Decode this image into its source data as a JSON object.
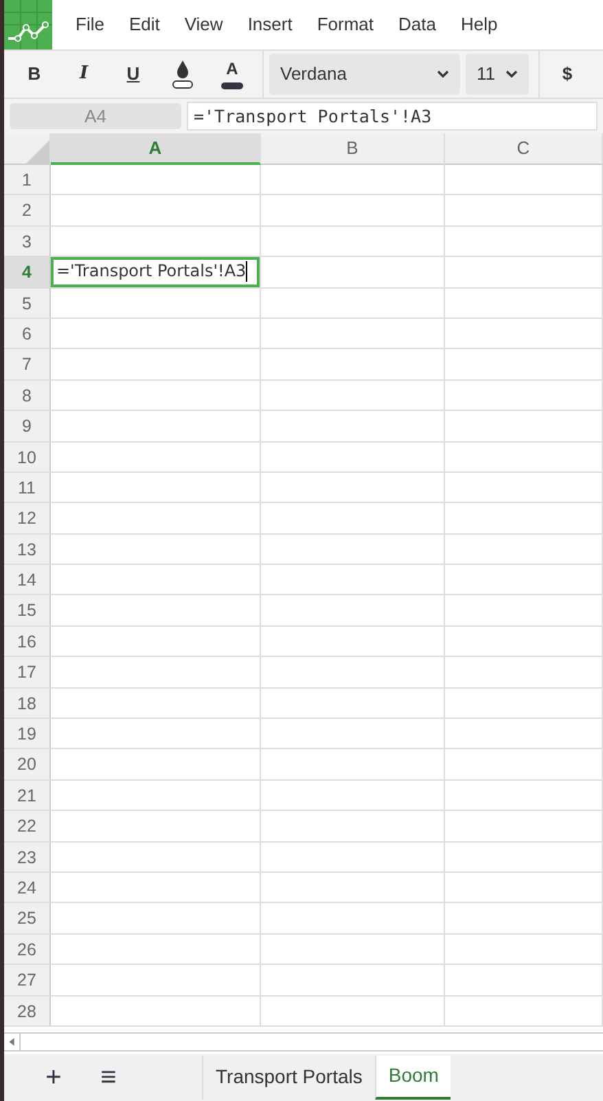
{
  "menu": [
    "File",
    "Edit",
    "View",
    "Insert",
    "Format",
    "Data",
    "Help"
  ],
  "toolbar": {
    "bold": "B",
    "italic": "I",
    "underline": "U",
    "text_color": "A",
    "font": "Verdana",
    "size": "11",
    "currency": "$"
  },
  "name_box": "A4",
  "formula": "='Transport Portals'!A3",
  "columns": [
    {
      "label": "A",
      "selected": true
    },
    {
      "label": "B",
      "selected": false
    },
    {
      "label": "C",
      "selected": false
    }
  ],
  "rows": [
    {
      "label": "1",
      "selected": false
    },
    {
      "label": "2",
      "selected": false
    },
    {
      "label": "3",
      "selected": false
    },
    {
      "label": "4",
      "selected": true,
      "editor_value": "='Transport Portals'!A3"
    },
    {
      "label": "5",
      "selected": false
    },
    {
      "label": "6",
      "selected": false
    },
    {
      "label": "7",
      "selected": false
    },
    {
      "label": "8",
      "selected": false
    },
    {
      "label": "9",
      "selected": false
    },
    {
      "label": "10",
      "selected": false
    },
    {
      "label": "11",
      "selected": false
    },
    {
      "label": "12",
      "selected": false
    },
    {
      "label": "13",
      "selected": false
    },
    {
      "label": "14",
      "selected": false
    },
    {
      "label": "15",
      "selected": false
    },
    {
      "label": "16",
      "selected": false
    },
    {
      "label": "17",
      "selected": false
    },
    {
      "label": "18",
      "selected": false
    },
    {
      "label": "19",
      "selected": false
    },
    {
      "label": "20",
      "selected": false
    },
    {
      "label": "21",
      "selected": false
    },
    {
      "label": "22",
      "selected": false
    },
    {
      "label": "23",
      "selected": false
    },
    {
      "label": "24",
      "selected": false
    },
    {
      "label": "25",
      "selected": false
    },
    {
      "label": "26",
      "selected": false
    },
    {
      "label": "27",
      "selected": false
    },
    {
      "label": "28",
      "selected": false
    }
  ],
  "sheet_buttons": [
    "+",
    "≡"
  ],
  "sheets": [
    {
      "label": "Transport Portals",
      "selected": false
    },
    {
      "label": "Boom",
      "selected": true
    }
  ]
}
